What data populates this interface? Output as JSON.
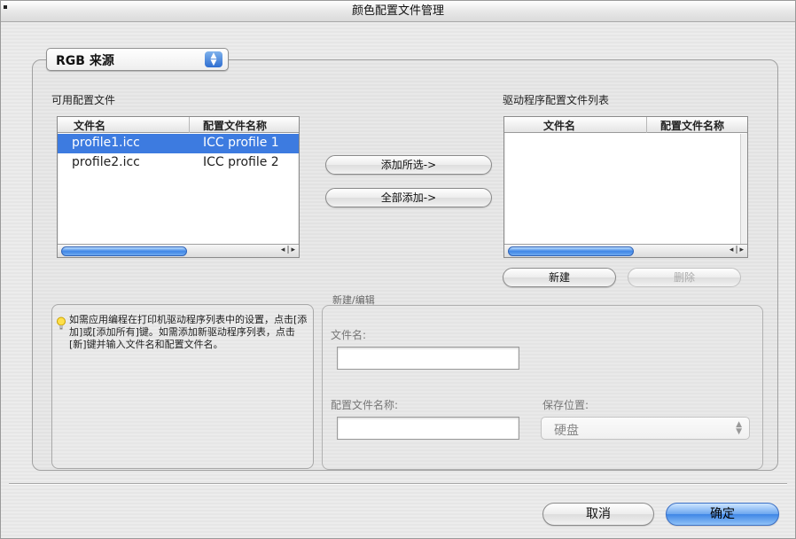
{
  "window": {
    "title": "颜色配置文件管理"
  },
  "source_popup": {
    "value": "RGB 来源"
  },
  "available": {
    "label": "可用配置文件",
    "col_filename": "文件名",
    "col_profile": "配置文件名称",
    "rows": [
      {
        "filename": "profile1.icc",
        "profile": "ICC profile 1",
        "selected": true
      },
      {
        "filename": "profile2.icc",
        "profile": "ICC profile 2",
        "selected": false
      }
    ]
  },
  "driver_list": {
    "label": "驱动程序配置文件列表",
    "col_filename": "文件名",
    "col_profile": "配置文件名称",
    "rows": []
  },
  "buttons": {
    "add_selected": "添加所选->",
    "add_all": "全部添加->",
    "new": "新建",
    "delete": "删除",
    "cancel": "取消",
    "ok": "确定"
  },
  "info": {
    "text": "如需应用编程在打印机驱动程序列表中的设置，点击[添加]或[添加所有]键。如需添加新驱动程序列表，点击[新]键并输入文件名和配置文件名。"
  },
  "edit": {
    "group_label": "新建/编辑",
    "filename_label": "文件名:",
    "filename_value": "",
    "profile_label": "配置文件名称:",
    "profile_value": "",
    "save_label": "保存位置:",
    "save_value": "硬盘"
  },
  "colors": {
    "accent": "#3d7be0",
    "primary_button": "#6ba6ef"
  }
}
